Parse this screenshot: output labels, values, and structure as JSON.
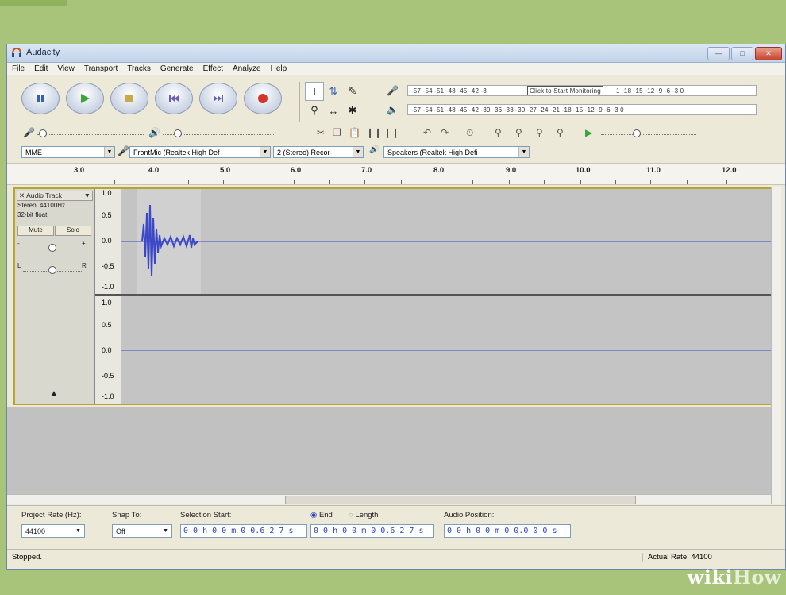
{
  "window": {
    "title": "Audacity",
    "controls": [
      "min",
      "max",
      "close"
    ]
  },
  "menu": [
    "File",
    "Edit",
    "View",
    "Transport",
    "Tracks",
    "Generate",
    "Effect",
    "Analyze",
    "Help"
  ],
  "meters": {
    "record_scale": "-57 -54 -51 -48 -45 -42 -3",
    "record_scale_right": "1 -18 -15 -12 -9 -6 -3 0",
    "monitor_button": "Click to Start Monitoring",
    "play_scale": "-57 -54 -51 -48 -45 -42 -39 -36 -33 -30 -27 -24 -21 -18 -15 -12 -9 -6 -3 0"
  },
  "devices": {
    "host": "MME",
    "input": "FrontMic (Realtek High Def",
    "channels": "2 (Stereo) Recor",
    "output": "Speakers (Realtek High Defi"
  },
  "ruler": [
    "3.0",
    "4.0",
    "5.0",
    "6.0",
    "7.0",
    "8.0",
    "9.0",
    "10.0",
    "11.0",
    "12.0"
  ],
  "track": {
    "name": "Audio Track",
    "format": "Stereo, 44100Hz",
    "sample": "32-bit float",
    "mute": "Mute",
    "solo": "Solo",
    "gain_minus": "-",
    "gain_plus": "+",
    "pan_left": "L",
    "pan_right": "R",
    "yaxis_top": [
      "1.0",
      "0.5",
      "0.0",
      "-0.5",
      "-1.0"
    ],
    "yaxis_bottom": [
      "1.0",
      "0.5",
      "0.0",
      "-0.5",
      "-1.0"
    ]
  },
  "selection": {
    "project_rate_label": "Project Rate (Hz):",
    "project_rate": "44100",
    "snap_label": "Snap To:",
    "snap": "Off",
    "start_label": "Selection Start:",
    "end_label": "End",
    "length_label": "Length",
    "start": "0 0 h 0 0 m 0 0.6 2 7 s",
    "end": "0 0 h 0 0 m 0 0.6 2 7 s",
    "audio_position_label": "Audio Position:",
    "audio_position": "0 0 h 0 0 m 0 0.0 0 0 s"
  },
  "status": {
    "left": "Stopped.",
    "right": "Actual Rate: 44100"
  },
  "watermark": {
    "wiki": "wiki",
    "how": "How"
  },
  "colors": {
    "waveform": "#3b48c8",
    "track_bg": "#c4c4c4",
    "selection_border": "#b5a52e",
    "record_red": "#d2352a",
    "play_green": "#3aa63a"
  }
}
